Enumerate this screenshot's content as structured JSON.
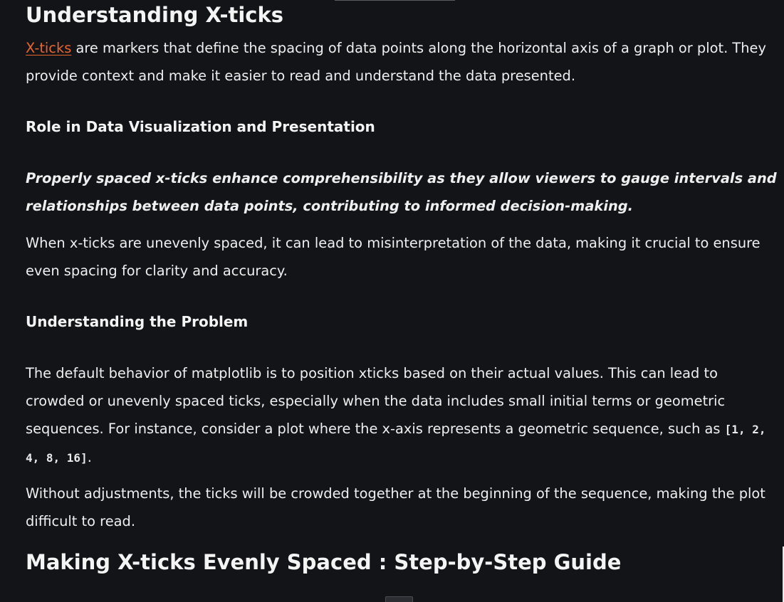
{
  "section1": {
    "heading": "Understanding X-ticks",
    "intro_link": "X-ticks",
    "intro_text": " are markers that define the spacing of data points along the horizontal axis of a graph or plot. They provide context and make it easier to read and understand the data presented."
  },
  "section2": {
    "heading": "Role in Data Visualization and Presentation",
    "emphasis": "Properly spaced x-ticks enhance comprehensibility as they allow viewers to gauge intervals and relationships between data points, contributing to informed decision-making.",
    "body": "When x-ticks are unevenly spaced, it can lead to misinterpretation of the data, making it crucial to ensure even spacing for clarity and accuracy."
  },
  "section3": {
    "heading": "Understanding the Problem",
    "body_before_code": "The default behavior of matplotlib is to position xticks based on their actual values. This can lead to crowded or unevenly spaced ticks, especially when the data includes small initial terms or geometric sequences. For instance, consider a plot where the x-axis represents a geometric sequence, such as ",
    "code": "[1, 2, 4, 8, 16]",
    "body_after_code": ".",
    "body2": "Without adjustments, the ticks will be crowded together at the beginning of the sequence, making the plot difficult to read."
  },
  "section4": {
    "heading": "Making X-ticks Evenly Spaced : Step-by-Step Guide"
  },
  "colors": {
    "background": "#131417",
    "link": "#e8652e",
    "text": "#efefef"
  }
}
